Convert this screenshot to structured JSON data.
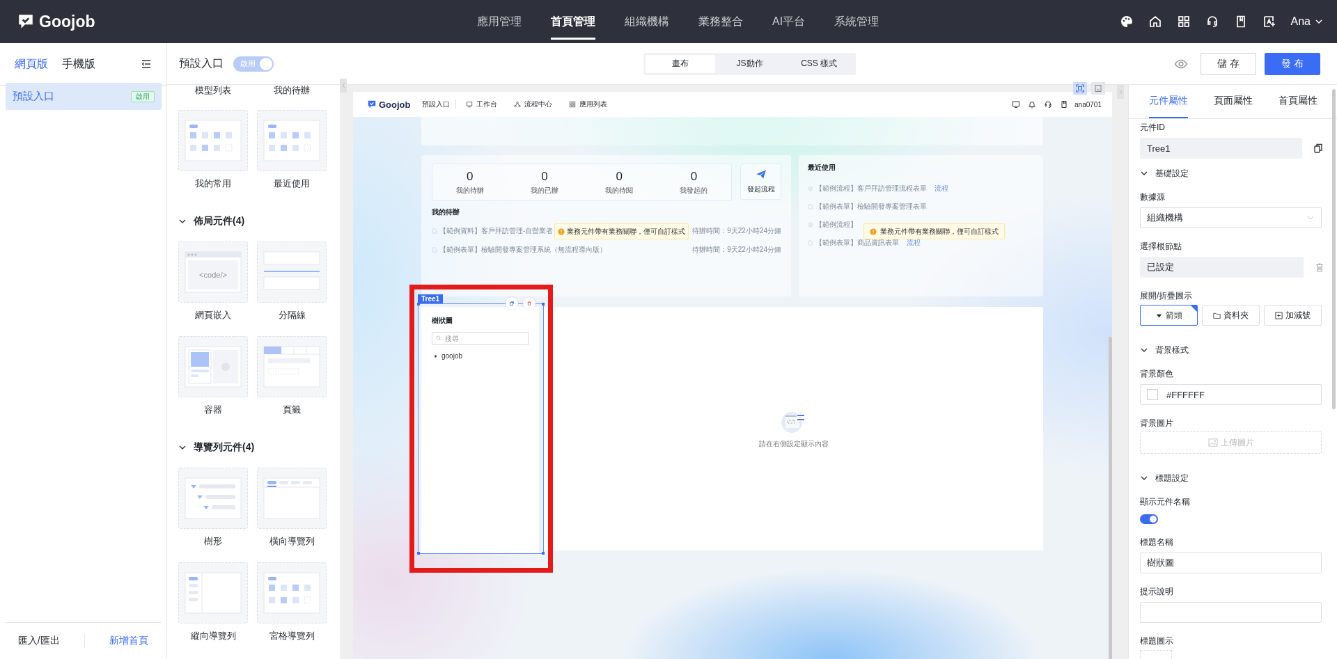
{
  "header": {
    "logo": "Goojob",
    "nav": [
      {
        "label": "應用管理",
        "selected": false
      },
      {
        "label": "首頁管理",
        "selected": true
      },
      {
        "label": "組織機構",
        "selected": false
      },
      {
        "label": "業務整合",
        "selected": false
      },
      {
        "label": "AI平台",
        "selected": false
      },
      {
        "label": "系統管理",
        "selected": false
      }
    ],
    "user": "Ana"
  },
  "sidebar": {
    "tabs": [
      {
        "label": "網頁版",
        "selected": true
      },
      {
        "label": "手機版",
        "selected": false
      }
    ],
    "items": [
      {
        "label": "預設入口",
        "badge": "啟用",
        "selected": true
      }
    ],
    "footer": {
      "import_export": "匯入/匯出",
      "add_page": "新增首頁"
    }
  },
  "toolbar": {
    "title": "預設入口",
    "switch": {
      "label": "啟用",
      "on": true
    },
    "modes": [
      {
        "label": "畫布",
        "selected": true
      },
      {
        "label": "JS動作",
        "selected": false
      },
      {
        "label": "CSS 樣式",
        "selected": false
      }
    ],
    "save": "儲 存",
    "publish": "發 布"
  },
  "palette": {
    "leading_labels": [
      "模型列表",
      "我的待辦"
    ],
    "leading_items": [
      {
        "label": "我的常用",
        "kind": "grid"
      },
      {
        "label": "最近使用",
        "kind": "grid"
      }
    ],
    "sections": [
      {
        "title": "佈局元件(4)",
        "expanded": true,
        "items": [
          {
            "label": "網頁嵌入",
            "kind": "code",
            "code_text": "<code/>"
          },
          {
            "label": "分隔線",
            "kind": "divider"
          },
          {
            "label": "容器",
            "kind": "container"
          },
          {
            "label": "頁籤",
            "kind": "tabs"
          }
        ]
      },
      {
        "title": "導覽列元件(4)",
        "expanded": true,
        "items": [
          {
            "label": "樹形",
            "kind": "tree"
          },
          {
            "label": "橫向導覽列",
            "kind": "hnav"
          },
          {
            "label": "縱向導覽列",
            "kind": "vnav"
          },
          {
            "label": "宮格導覽列",
            "kind": "grid"
          }
        ]
      }
    ]
  },
  "canvas": {
    "view_toggles": [
      {
        "selected": true
      },
      {
        "selected": false
      }
    ],
    "preview": {
      "logo": "Goojob",
      "title": "預設入口",
      "nav": [
        "工作台",
        "流程中心",
        "應用列表"
      ],
      "user": "ana0701",
      "stats": [
        {
          "value": "0",
          "label": "我的待辦"
        },
        {
          "value": "0",
          "label": "我的已辦"
        },
        {
          "value": "0",
          "label": "我的待閱"
        },
        {
          "value": "0",
          "label": "我發起的"
        }
      ],
      "launch": "發起流程",
      "todo_title": "我的待辦",
      "todos": [
        {
          "title": "【範例資料】客戶拜訪管理-自營業者",
          "time": "待辦時間：9天22小時24分鐘"
        },
        {
          "title": "【範例表單】檢驗開發專案管理系統（無流程導向版）",
          "time": "待辦時間：9天22小時24分鐘"
        }
      ],
      "recent_title": "最近使用",
      "recents": [
        {
          "title": "【範例流程】客戶拜訪管理流程表單",
          "tag": "流程"
        },
        {
          "title": "【範例表單】檢驗開發專案管理表單"
        },
        {
          "title": "【範例流程】"
        },
        {
          "title": "【範例表單】商品資訊表單",
          "tag": "流程"
        }
      ],
      "notices": [
        "業務元件帶有業務關聯，僅可自訂樣式",
        "業務元件帶有業務關聯，僅可自訂樣式"
      ],
      "tree": {
        "badge": "Tree1",
        "title": "樹狀圖",
        "search_placeholder": "搜尋",
        "nodes": [
          {
            "label": "goojob",
            "expanded": false
          }
        ]
      },
      "empty_hint": "請在右側設定顯示內容"
    }
  },
  "props": {
    "tabs": [
      {
        "label": "元件屬性",
        "selected": true
      },
      {
        "label": "頁面屬性",
        "selected": false
      },
      {
        "label": "首頁屬性",
        "selected": false
      }
    ],
    "id_label": "元件ID",
    "id_value": "Tree1",
    "basic": {
      "title": "基礎設定",
      "expanded": true,
      "source_label": "數據源",
      "source_value": "組織機構",
      "root_label": "選擇根節點",
      "root_value": "已設定",
      "icon_label": "展開/折疊圖示",
      "icon_options": [
        {
          "label": "箭頭",
          "selected": true
        },
        {
          "label": "資料夾",
          "selected": false
        },
        {
          "label": "加減號",
          "selected": false
        }
      ]
    },
    "background": {
      "title": "背景樣式",
      "expanded": true,
      "color_label": "背景顏色",
      "color_value": "#FFFFFF",
      "image_label": "背景圖片",
      "upload": "上傳圖片"
    },
    "title_settings": {
      "title": "標題設定",
      "expanded": true,
      "show_label": "顯示元件名稱",
      "show_on": true,
      "name_label": "標題名稱",
      "name_value": "樹狀圖",
      "hint_label": "提示說明",
      "icon_label": "標題圖示"
    }
  }
}
